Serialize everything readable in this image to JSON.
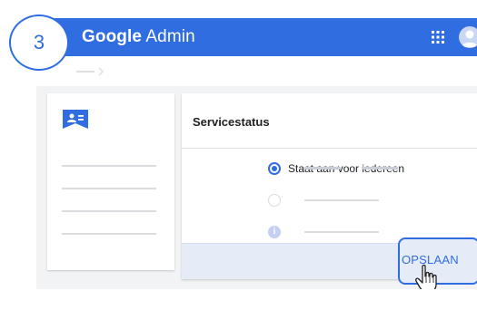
{
  "step": {
    "number": "3"
  },
  "header": {
    "brand_google": "Google",
    "brand_admin": "Admin"
  },
  "card": {
    "title": "Servicestatus",
    "option_selected": "Staat aan voor iedereen",
    "save_label": "OPSLAAN"
  },
  "colors": {
    "brand_blue": "#2f6de1",
    "footer_bg": "#e6ebf8",
    "placeholder": "#dadce0"
  },
  "icons": {
    "apps": "grid-icon",
    "avatar": "user-avatar-icon",
    "sidebar": "people-card-icon",
    "info": "info-icon",
    "cursor": "hand-pointer-icon"
  }
}
